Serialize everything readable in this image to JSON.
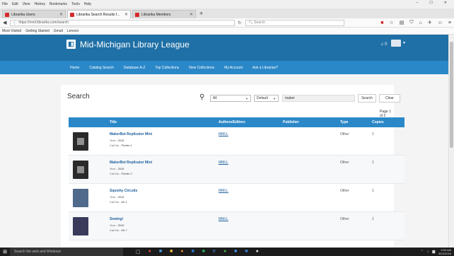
{
  "browser": {
    "menu": [
      "File",
      "Edit",
      "View",
      "History",
      "Bookmarks",
      "Tools",
      "Help"
    ],
    "tabs": [
      {
        "label": "Librarika Users",
        "active": false
      },
      {
        "label": "Librarika Search Results f...",
        "active": true
      },
      {
        "label": "Librarika Members",
        "active": false
      }
    ],
    "url": "https://mml.librarika.com/search",
    "search_placeholder": "Search",
    "bookmarks": [
      "Most Visited",
      "Getting Started",
      "Gmail",
      "Lenovo"
    ]
  },
  "site": {
    "title": "Mid-Michigan Library League",
    "notifications": "0",
    "nav": [
      "Home",
      "Catalog Search",
      "Database A-Z",
      "Top Collections",
      "New Collections",
      "My Account",
      "Ask a Librarian?"
    ]
  },
  "search": {
    "heading": "Search",
    "field": "All",
    "sort": "Default",
    "query": "maker",
    "search_button": "Search",
    "clear_button": "Clear",
    "pager": "Page 1 of 2"
  },
  "table": {
    "headers": [
      "Title",
      "Authors/Editors",
      "Publisher",
      "Type",
      "Copies"
    ],
    "rows": [
      {
        "title": "MakerBot Replicator Mini",
        "year_label": "Year :",
        "year": "2016",
        "call_label": "Call No :",
        "call": "Printer 1",
        "author": "MMLL",
        "type": "Other",
        "copies": "1"
      },
      {
        "title": "MakerBot Replicator Mini",
        "year_label": "Year :",
        "year": "2016",
        "call_label": "Call No :",
        "call": "Printer 2",
        "author": "MMLL",
        "type": "Other",
        "copies": "1"
      },
      {
        "title": "Squishy Circuits",
        "year_label": "Year :",
        "year": "2016",
        "call_label": "Call No :",
        "call": "Kit 1",
        "author": "MMLL",
        "type": "Other",
        "copies": "1"
      },
      {
        "title": "Sewing!",
        "year_label": "Year :",
        "year": "2016",
        "call_label": "Call No :",
        "call": "Kit 7",
        "author": "MMLL",
        "type": "Other",
        "copies": "1"
      }
    ]
  },
  "taskbar": {
    "search_placeholder": "Search the web and Windows",
    "time": "9:53 AM",
    "date": "8/24/2016"
  }
}
